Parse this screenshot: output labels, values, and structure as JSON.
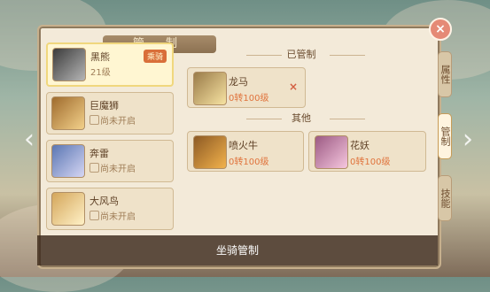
{
  "window": {
    "title": "管 制",
    "close_icon": "close-icon"
  },
  "left_list": [
    {
      "name": "黑熊",
      "level": "21级",
      "status": "",
      "badge": "乘骑",
      "active": true
    },
    {
      "name": "巨魔狮",
      "level": "",
      "status": "尚未开启",
      "badge": "",
      "active": false
    },
    {
      "name": "奔雷",
      "level": "",
      "status": "尚未开启",
      "badge": "",
      "active": false
    },
    {
      "name": "大风鸟",
      "level": "",
      "status": "尚未开启",
      "badge": "",
      "active": false
    }
  ],
  "sections": {
    "managed_title": "已管制",
    "others_title": "其他"
  },
  "managed": [
    {
      "name": "龙马",
      "level": "0转100级",
      "remove": "×"
    }
  ],
  "others": [
    {
      "name": "喷火牛",
      "level": "0转100级"
    },
    {
      "name": "花妖",
      "level": "0转100级"
    }
  ],
  "tabs": [
    "属性",
    "管制",
    "技能"
  ],
  "bottom": {
    "title": "坐骑管制"
  },
  "colors": {
    "accent": "#e0733c",
    "panel": "#f3ead9",
    "active_tab": "#fff4df"
  }
}
